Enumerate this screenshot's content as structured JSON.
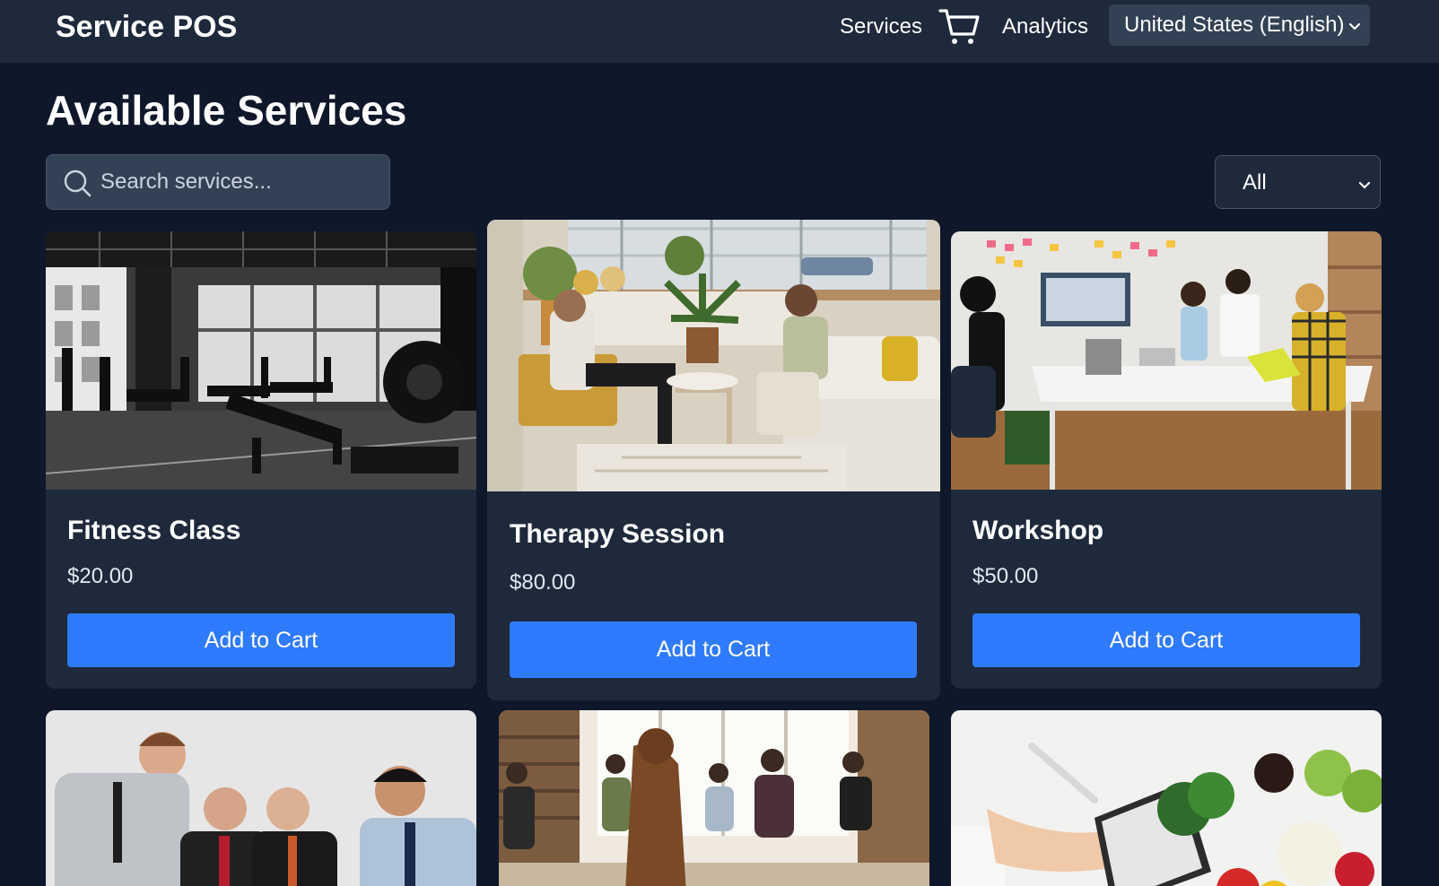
{
  "app": {
    "brand": "Service POS"
  },
  "nav": {
    "services_label": "Services",
    "cart_icon": "shopping-cart-icon",
    "analytics_label": "Analytics",
    "language_selected": "United States (English)"
  },
  "page": {
    "title": "Available Services"
  },
  "search": {
    "placeholder": "Search services...",
    "value": "",
    "icon": "search-icon"
  },
  "filter": {
    "selected": "All"
  },
  "services": [
    {
      "name": "Fitness Class",
      "price": "$20.00",
      "button_label": "Add to Cart",
      "image": "gym-photo"
    },
    {
      "name": "Therapy Session",
      "price": "$80.00",
      "button_label": "Add to Cart",
      "image": "therapy-room-photo"
    },
    {
      "name": "Workshop",
      "price": "$50.00",
      "button_label": "Add to Cart",
      "image": "office-meeting-photo"
    },
    {
      "name": "",
      "price": "",
      "button_label": "",
      "image": "business-meeting-photo"
    },
    {
      "name": "",
      "price": "",
      "button_label": "",
      "image": "yoga-class-photo"
    },
    {
      "name": "",
      "price": "",
      "button_label": "",
      "image": "nutrition-photo"
    }
  ],
  "colors": {
    "page_background": "#0f172a",
    "header_background": "#1e293b",
    "card_background": "#1e293b",
    "input_background": "#334155",
    "accent_button": "#2f7bff"
  }
}
